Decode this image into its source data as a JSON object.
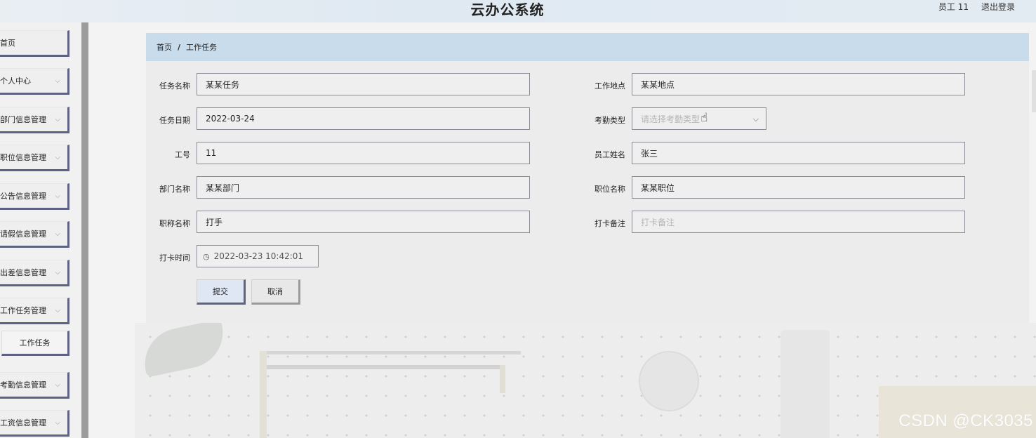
{
  "header": {
    "app_title": "云办公系统",
    "user_label": "员工 11",
    "logout_label": "退出登录"
  },
  "sidebar": {
    "items": [
      {
        "label": "首页",
        "has_chevron": false
      },
      {
        "label": "个人中心",
        "has_chevron": true
      },
      {
        "label": "部门信息管理",
        "has_chevron": true
      },
      {
        "label": "职位信息管理",
        "has_chevron": true
      },
      {
        "label": "公告信息管理",
        "has_chevron": true
      },
      {
        "label": "请假信息管理",
        "has_chevron": true
      },
      {
        "label": "出差信息管理",
        "has_chevron": true
      },
      {
        "label": "工作任务管理",
        "has_chevron": true
      },
      {
        "label": "考勤信息管理",
        "has_chevron": true
      },
      {
        "label": "工资信息管理",
        "has_chevron": true
      }
    ],
    "submenu": {
      "label": "工作任务"
    },
    "chevron_glyph": "⌵"
  },
  "breadcrumb": {
    "home": "首页",
    "separator": "/",
    "current": "工作任务"
  },
  "form": {
    "task_name": {
      "label": "任务名称",
      "value": "某某任务"
    },
    "task_date": {
      "label": "任务日期",
      "value": "2022-03-24"
    },
    "employee_no": {
      "label": "工号",
      "value": "11"
    },
    "department_name": {
      "label": "部门名称",
      "value": "某某部门"
    },
    "title_name": {
      "label": "职称名称",
      "value": "打手"
    },
    "checkin_time": {
      "label": "打卡时间",
      "value": "2022-03-23 10:42:01"
    },
    "work_location": {
      "label": "工作地点",
      "value": "某某地点"
    },
    "attendance_type": {
      "label": "考勤类型",
      "placeholder": "请选择考勤类型"
    },
    "employee_name": {
      "label": "员工姓名",
      "value": "张三"
    },
    "position_name": {
      "label": "职位名称",
      "value": "某某职位"
    },
    "checkin_note": {
      "label": "打卡备注",
      "placeholder": "打卡备注"
    }
  },
  "buttons": {
    "submit": "提交",
    "cancel": "取消"
  },
  "watermark": "CSDN @CK3035",
  "colors": {
    "accent_border": "#5f6183",
    "breadcrumb_bg": "#c8dcec",
    "sidebar_scrollbar": "#9c9c9c"
  }
}
